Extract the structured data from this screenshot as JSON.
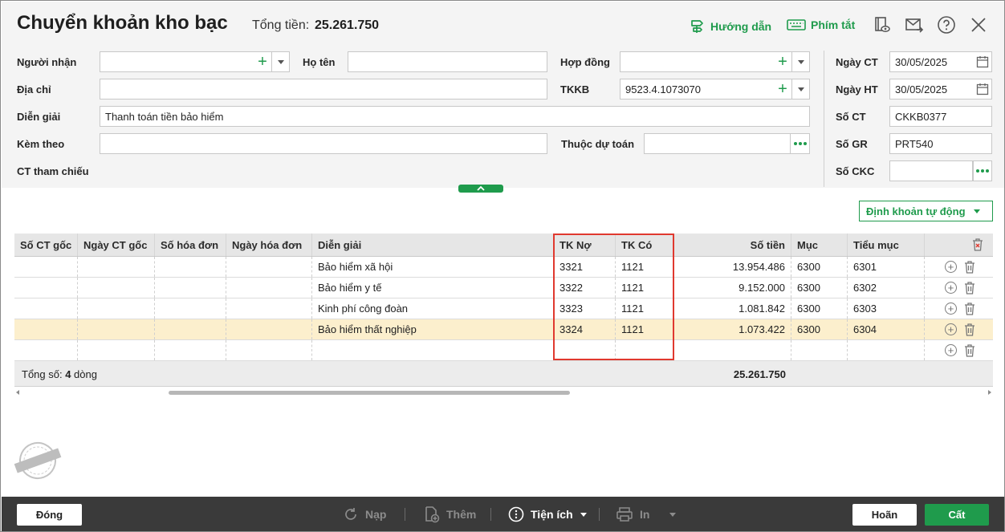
{
  "header": {
    "title": "Chuyển khoản kho bạc",
    "total_label": "Tổng tiền:",
    "total_value": "25.261.750",
    "guide_label": "Hướng dẫn",
    "shortcut_label": "Phím tắt"
  },
  "form": {
    "recipient_label": "Người nhận",
    "recipient_value": "",
    "fullname_label": "Họ tên",
    "fullname_value": "",
    "contract_label": "Hợp đồng",
    "contract_value": "",
    "address_label": "Địa chỉ",
    "address_value": "",
    "tkkb_label": "TKKB",
    "tkkb_value": "9523.4.1073070",
    "description_label": "Diễn giải",
    "description_value": "Thanh toán tiền bảo hiểm",
    "attach_label": "Kèm theo",
    "attach_value": "",
    "budget_label": "Thuộc dự toán",
    "budget_value": "",
    "reference_label": "CT tham chiếu",
    "doc_date_label": "Ngày CT",
    "doc_date_value": "30/05/2025",
    "post_date_label": "Ngày HT",
    "post_date_value": "30/05/2025",
    "doc_no_label": "Số CT",
    "doc_no_value": "CKKB0377",
    "gr_no_label": "Số GR",
    "gr_no_value": "PRT540",
    "ckc_no_label": "Số CKC",
    "ckc_no_value": ""
  },
  "auto_entry_label": "Định khoản tự động",
  "grid": {
    "columns": [
      "Số CT gốc",
      "Ngày CT gốc",
      "Số hóa đơn",
      "Ngày hóa đơn",
      "Diễn giải",
      "TK Nợ",
      "TK Có",
      "Số tiền",
      "Mục",
      "Tiểu mục"
    ],
    "rows": [
      {
        "desc": "Bảo hiểm xã hội",
        "debit": "3321",
        "credit": "1121",
        "amount": "13.954.486",
        "item": "6300",
        "subitem": "6301"
      },
      {
        "desc": "Bảo hiểm y tế",
        "debit": "3322",
        "credit": "1121",
        "amount": "9.152.000",
        "item": "6300",
        "subitem": "6302"
      },
      {
        "desc": "Kinh phí công đoàn",
        "debit": "3323",
        "credit": "1121",
        "amount": "1.081.842",
        "item": "6300",
        "subitem": "6303"
      },
      {
        "desc": "Bảo hiểm thất nghiệp",
        "debit": "3324",
        "credit": "1121",
        "amount": "1.073.422",
        "item": "6300",
        "subitem": "6304"
      }
    ],
    "footer_prefix": "Tổng số: ",
    "footer_count": "4",
    "footer_suffix": " dòng",
    "footer_total": "25.261.750"
  },
  "stamp_text": "DỮ LIỆU MẪU",
  "footer": {
    "close_label": "Đóng",
    "load_label": "Nạp",
    "add_label": "Thêm",
    "utilities_label": "Tiện ích",
    "print_label": "In",
    "cancel_label": "Hoãn",
    "save_label": "Cất"
  },
  "colors": {
    "accent": "#1f9b4c",
    "highlight_row": "#fcefcd",
    "annotation_box": "#e0392f",
    "footer_bar": "#3a3a3a"
  }
}
